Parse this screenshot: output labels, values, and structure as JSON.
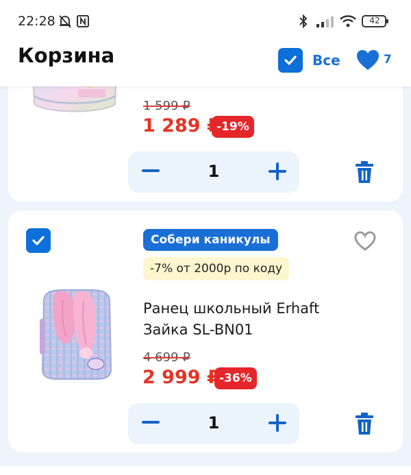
{
  "status_bar": {
    "time": "22:28",
    "battery": "42"
  },
  "header": {
    "title": "Корзина",
    "select_all_label": "Все",
    "favorites_count": "7"
  },
  "items": [
    {
      "old_price": "1 599 ₽",
      "new_price": "1 289 ₽",
      "discount": "-19%",
      "quantity": "1"
    },
    {
      "promo_badge": "Собери каникулы",
      "promo_code": "-7% от 2000р по коду",
      "name": "Ранец школьный Erhaft Зайка SL-BN01",
      "old_price": "4 699 ₽",
      "new_price": "2 999 ₽",
      "discount": "-36%",
      "quantity": "1"
    }
  ],
  "colors": {
    "accent": "#0d6fd9",
    "price_red": "#e53324",
    "discount_bg": "#e5262a",
    "promo_yellow": "#fdf6cf",
    "page_bg": "#eef4fb"
  },
  "icons": {
    "status": [
      "bell-muted-icon",
      "nfc-icon",
      "bluetooth-icon",
      "signal-icon",
      "wifi-icon",
      "battery-icon"
    ],
    "header": [
      "checkbox-checked-icon",
      "heart-icon"
    ],
    "item": [
      "minus-icon",
      "plus-icon",
      "trash-icon",
      "heart-outline-icon"
    ]
  }
}
